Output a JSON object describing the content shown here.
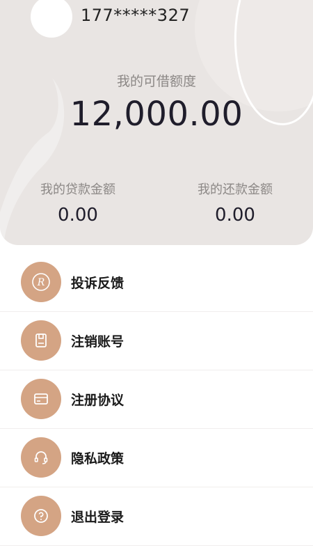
{
  "header": {
    "phone": "177*****327",
    "credit_label": "我的可借额度",
    "credit_amount": "12,000.00",
    "loan_label": "我的贷款金额",
    "loan_value": "0.00",
    "repay_label": "我的还款金额",
    "repay_value": "0.00"
  },
  "menu": {
    "items": [
      {
        "label": "投诉反馈",
        "icon": "r-logo-icon"
      },
      {
        "label": "注销账号",
        "icon": "document-icon"
      },
      {
        "label": "注册协议",
        "icon": "card-icon"
      },
      {
        "label": "隐私政策",
        "icon": "headset-icon"
      },
      {
        "label": "退出登录",
        "icon": "question-icon"
      }
    ]
  },
  "colors": {
    "header_bg": "#e9e5e3",
    "icon_bg": "#d4a484",
    "text_dark": "#1f1d2b",
    "text_muted": "#8c8886"
  }
}
